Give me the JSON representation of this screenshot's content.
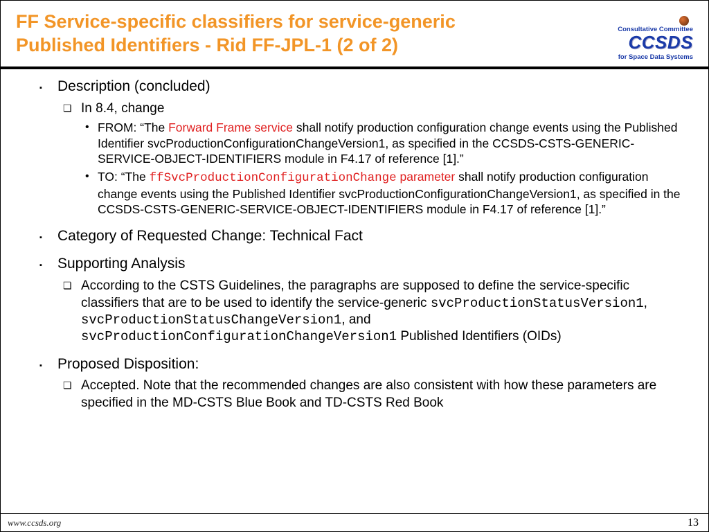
{
  "header": {
    "title": "FF Service-specific classifiers for service-generic Published Identifiers - Rid FF-JPL-1 (2 of 2)",
    "logo": {
      "line1": "Consultative Committee",
      "brand": "CCSDS",
      "line2": "for Space Data Systems"
    }
  },
  "content": {
    "l1": [
      {
        "text": "Description (concluded)",
        "l2": [
          {
            "text": "In 8.4, change",
            "l3": [
              {
                "segments": [
                  {
                    "t": "FROM: “The ",
                    "c": ""
                  },
                  {
                    "t": "Forward Frame service",
                    "c": "red"
                  },
                  {
                    "t": " shall notify production configuration change events using the Published Identifier svcProductionConfigurationChangeVersion1, as specified in the CCSDS-CSTS-GENERIC-SERVICE-OBJECT-IDENTIFIERS module in F4.17 of reference [1].”",
                    "c": ""
                  }
                ]
              },
              {
                "segments": [
                  {
                    "t": "TO: “The ",
                    "c": ""
                  },
                  {
                    "t": "ffSvcProductionConfigurationChange",
                    "c": "monored"
                  },
                  {
                    "t": " parameter",
                    "c": "red"
                  },
                  {
                    "t": " shall notify production configuration change events using the Published Identifier svcProductionConfigurationChangeVersion1, as specified in the CCSDS-CSTS-GENERIC-SERVICE-OBJECT-IDENTIFIERS module in F4.17 of reference [1].”",
                    "c": ""
                  }
                ]
              }
            ]
          }
        ]
      },
      {
        "text": "Category of Requested Change: Technical Fact"
      },
      {
        "text": "Supporting Analysis",
        "l2": [
          {
            "segments": [
              {
                "t": "According to the CSTS Guidelines, the paragraphs are supposed to define the service-specific classifiers that are to be used to identify the service-generic ",
                "c": ""
              },
              {
                "t": "svcProductionStatusVersion1",
                "c": "mono"
              },
              {
                "t": ", ",
                "c": ""
              },
              {
                "t": "svcProductionStatusChangeVersion1",
                "c": "mono"
              },
              {
                "t": ", and ",
                "c": ""
              },
              {
                "t": "svcProductionConfigurationChangeVersion1",
                "c": "mono"
              },
              {
                "t": " Published Identifiers (OIDs)",
                "c": ""
              }
            ]
          }
        ]
      },
      {
        "text": "Proposed Disposition:",
        "l2": [
          {
            "text": "Accepted. Note that the recommended changes are also consistent with how these parameters are specified in the MD-CSTS Blue Book and TD-CSTS Red Book"
          }
        ]
      }
    ]
  },
  "footer": {
    "url": "www.ccsds.org",
    "page": "13"
  }
}
